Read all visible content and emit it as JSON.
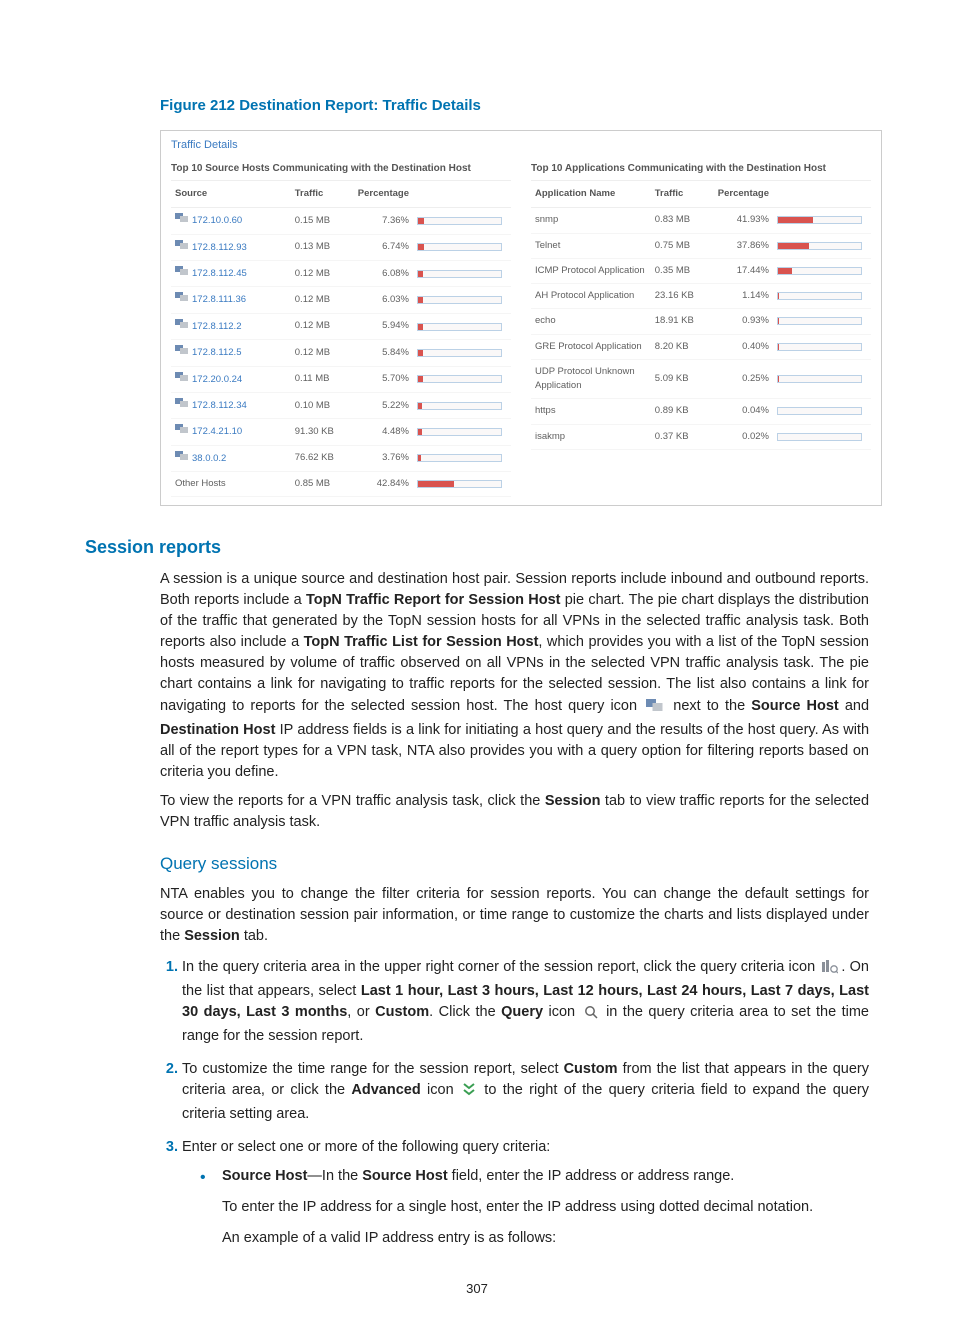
{
  "page_number": "307",
  "figure_caption": "Figure 212 Destination Report: Traffic Details",
  "fig": {
    "box_title": "Traffic Details",
    "left_sub": "Top 10 Source Hosts Communicating with the Destination Host",
    "right_sub": "Top 10 Applications Communicating with the Destination Host",
    "h_source": "Source",
    "h_app": "Application Name",
    "h_traffic": "Traffic",
    "h_pct": "Percentage",
    "other_hosts": "Other Hosts",
    "other_traffic": "0.85 MB",
    "other_pct": "42.84%",
    "hosts": [
      {
        "ip": "172.10.0.60",
        "traffic": "0.15 MB",
        "pct": "7.36%",
        "w": 7.36
      },
      {
        "ip": "172.8.112.93",
        "traffic": "0.13 MB",
        "pct": "6.74%",
        "w": 6.74
      },
      {
        "ip": "172.8.112.45",
        "traffic": "0.12 MB",
        "pct": "6.08%",
        "w": 6.08
      },
      {
        "ip": "172.8.111.36",
        "traffic": "0.12 MB",
        "pct": "6.03%",
        "w": 6.03
      },
      {
        "ip": "172.8.112.2",
        "traffic": "0.12 MB",
        "pct": "5.94%",
        "w": 5.94
      },
      {
        "ip": "172.8.112.5",
        "traffic": "0.12 MB",
        "pct": "5.84%",
        "w": 5.84
      },
      {
        "ip": "172.20.0.24",
        "traffic": "0.11 MB",
        "pct": "5.70%",
        "w": 5.7
      },
      {
        "ip": "172.8.112.34",
        "traffic": "0.10 MB",
        "pct": "5.22%",
        "w": 5.22
      },
      {
        "ip": "172.4.21.10",
        "traffic": "91.30 KB",
        "pct": "4.48%",
        "w": 4.48
      },
      {
        "ip": "38.0.0.2",
        "traffic": "76.62 KB",
        "pct": "3.76%",
        "w": 3.76
      }
    ],
    "apps": [
      {
        "name": "snmp",
        "traffic": "0.83 MB",
        "pct": "41.93%",
        "w": 41.93
      },
      {
        "name": "Telnet",
        "traffic": "0.75 MB",
        "pct": "37.86%",
        "w": 37.86
      },
      {
        "name": "ICMP Protocol Application",
        "traffic": "0.35 MB",
        "pct": "17.44%",
        "w": 17.44
      },
      {
        "name": "AH Protocol Application",
        "traffic": "23.16 KB",
        "pct": "1.14%",
        "w": 1.14
      },
      {
        "name": "echo",
        "traffic": "18.91 KB",
        "pct": "0.93%",
        "w": 0.93
      },
      {
        "name": "GRE Protocol Application",
        "traffic": "8.20 KB",
        "pct": "0.40%",
        "w": 0.4
      },
      {
        "name": "UDP Protocol Unknown Application",
        "traffic": "5.09 KB",
        "pct": "0.25%",
        "w": 0.25
      },
      {
        "name": "https",
        "traffic": "0.89 KB",
        "pct": "0.04%",
        "w": 0.04
      },
      {
        "name": "isakmp",
        "traffic": "0.37 KB",
        "pct": "0.02%",
        "w": 0.02
      }
    ]
  },
  "chart_data": [
    {
      "type": "bar",
      "title": "Top 10 Source Hosts Communicating with the Destination Host",
      "xlabel": "Source",
      "ylabel": "Percentage",
      "categories": [
        "172.10.0.60",
        "172.8.112.93",
        "172.8.112.45",
        "172.8.111.36",
        "172.8.112.2",
        "172.8.112.5",
        "172.20.0.24",
        "172.8.112.34",
        "172.4.21.10",
        "38.0.0.2",
        "Other Hosts"
      ],
      "values": [
        7.36,
        6.74,
        6.08,
        6.03,
        5.94,
        5.84,
        5.7,
        5.22,
        4.48,
        3.76,
        42.84
      ],
      "ylim": [
        0,
        100
      ]
    },
    {
      "type": "bar",
      "title": "Top 10 Applications Communicating with the Destination Host",
      "xlabel": "Application Name",
      "ylabel": "Percentage",
      "categories": [
        "snmp",
        "Telnet",
        "ICMP Protocol Application",
        "AH Protocol Application",
        "echo",
        "GRE Protocol Application",
        "UDP Protocol Unknown Application",
        "https",
        "isakmp"
      ],
      "values": [
        41.93,
        37.86,
        17.44,
        1.14,
        0.93,
        0.4,
        0.25,
        0.04,
        0.02
      ],
      "ylim": [
        0,
        100
      ]
    }
  ],
  "h2_session": "Session reports",
  "p1a": "A session is a unique source and destination host pair. Session reports include inbound and outbound reports. Both reports include a ",
  "p1b": "TopN Traffic Report for Session Host",
  "p1c": " pie chart. The pie chart displays the distribution of the traffic that generated by the TopN session hosts for all VPNs in the selected traffic analysis task. Both reports also include a ",
  "p1d": "TopN Traffic List for Session Host",
  "p1e": ", which provides you with a list of the TopN session hosts measured by volume of traffic observed on all VPNs in the selected VPN traffic analysis task. The pie chart contains a link for navigating to traffic reports for the selected session. The list also contains a link for navigating to reports for the selected session host. The host query icon ",
  "p1f": " next to the ",
  "p1g": "Source Host",
  "p1h": " and ",
  "p1i": "Destination Host",
  "p1j": " IP address fields is a link for initiating a host query and the results of the host query. As with all of the report types for a VPN task, NTA also provides you with a query option for filtering reports based on criteria you define.",
  "p2a": "To view the reports for a VPN traffic analysis task, click the ",
  "p2b": "Session",
  "p2c": " tab to view traffic reports for the selected VPN traffic analysis task.",
  "h3_query": "Query sessions",
  "p3a": "NTA enables you to change the filter criteria for session reports. You can change the default settings for source or destination session pair information, or time range to customize the charts and lists displayed under the ",
  "p3b": "Session",
  "p3c": " tab.",
  "step1a": "In the query criteria area in the upper right corner of the session report, click the query criteria icon ",
  "step1b": ". On the list that appears, select ",
  "step1c": "Last 1 hour, Last 3 hours, Last 12 hours, Last 24 hours, Last 7 days, Last 30 days, Last 3 months",
  "step1d": ", or ",
  "step1e": "Custom",
  "step1f": ". Click the ",
  "step1g": "Query",
  "step1h": " icon ",
  "step1i": " in the query criteria area to set the time range for the session report.",
  "step2a": "To customize the time range for the session report, select ",
  "step2b": "Custom",
  "step2c": " from the list that appears in the query criteria area, or click the ",
  "step2d": "Advanced",
  "step2e": " icon ",
  "step2f": " to the right of the query criteria field to expand the query criteria setting area.",
  "step3": "Enter or select one or more of the following query criteria:",
  "bullet_a1": "Source Host",
  "bullet_a2": "—In the ",
  "bullet_a3": "Source Host",
  "bullet_a4": " field, enter the IP address or address range.",
  "bullet_b": "To enter the IP address for a single host, enter the IP address using dotted decimal notation.",
  "bullet_c": "An example of a valid IP address entry is as follows:"
}
